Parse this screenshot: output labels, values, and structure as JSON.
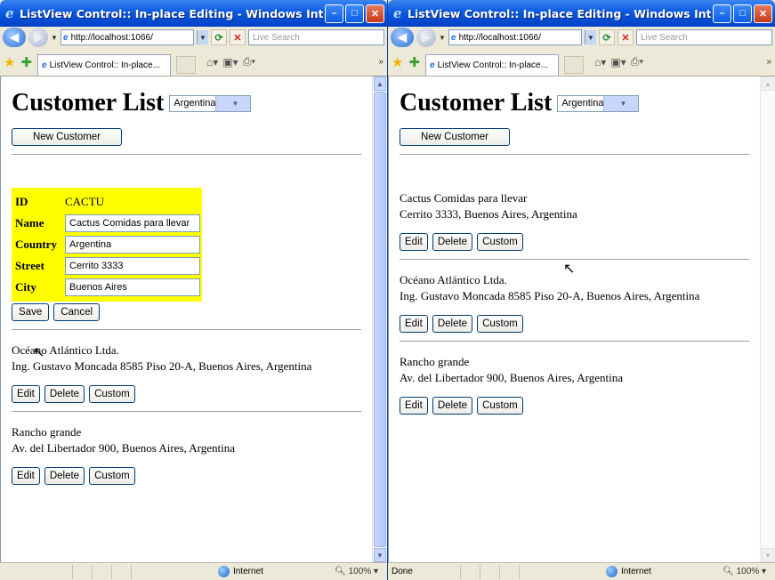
{
  "window1": {
    "title": "ListView Control:: In-place Editing - Windows Internet ...",
    "url": "http://localhost:1066/",
    "search_placeholder": "Live Search",
    "tab_label": "ListView Control:: In-place...",
    "status_text": "",
    "zone": "Internet",
    "zoom": "100%",
    "page": {
      "heading": "Customer List",
      "country_select": "Argentina",
      "new_button": "New Customer",
      "edit_form": {
        "id_label": "ID",
        "id_value": "CACTU",
        "name_label": "Name",
        "name_value": "Cactus Comidas para llevar",
        "country_label": "Country",
        "country_value": "Argentina",
        "street_label": "Street",
        "street_value": "Cerrito 3333",
        "city_label": "City",
        "city_value": "Buenos Aires",
        "save": "Save",
        "cancel": "Cancel"
      },
      "customers": [
        {
          "name": "Océano Atlántico Ltda.",
          "address": "Ing. Gustavo Moncada 8585 Piso 20-A, Buenos Aires, Argentina"
        },
        {
          "name": "Rancho grande",
          "address": "Av. del Libertador 900, Buenos Aires, Argentina"
        }
      ]
    }
  },
  "window2": {
    "title": "ListView Control:: In-place Editing - Windows Internet ...",
    "url": "http://localhost:1066/",
    "search_placeholder": "Live Search",
    "tab_label": "ListView Control:: In-place...",
    "status_text": "Done",
    "zone": "Internet",
    "zoom": "100%",
    "page": {
      "heading": "Customer List",
      "country_select": "Argentina",
      "new_button": "New Customer",
      "customers": [
        {
          "name": "Cactus Comidas para llevar",
          "address": "Cerrito 3333, Buenos Aires, Argentina"
        },
        {
          "name": "Océano Atlántico Ltda.",
          "address": "Ing. Gustavo Moncada 8585 Piso 20-A, Buenos Aires, Argentina"
        },
        {
          "name": "Rancho grande",
          "address": "Av. del Libertador 900, Buenos Aires, Argentina"
        }
      ]
    }
  },
  "actions": {
    "edit": "Edit",
    "delete": "Delete",
    "custom": "Custom"
  },
  "icons": [
    "ie-logo-icon",
    "back-icon",
    "forward-icon",
    "refresh-icon",
    "stop-icon",
    "favorites-star-icon",
    "add-favorites-icon",
    "home-icon",
    "feeds-icon",
    "print-icon",
    "globe-icon",
    "zoom-icon",
    "minimize-icon",
    "maximize-icon",
    "close-icon"
  ]
}
